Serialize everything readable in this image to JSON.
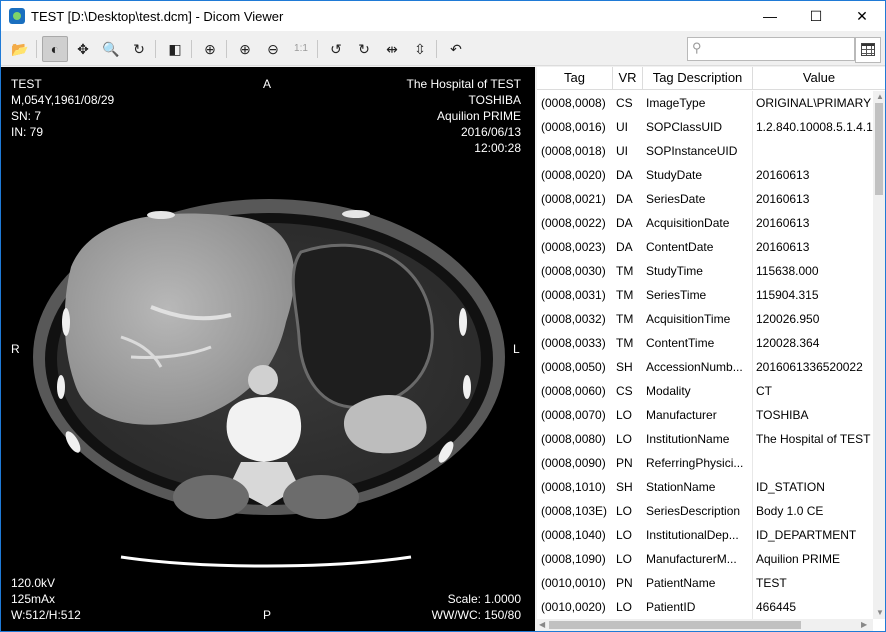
{
  "window": {
    "title": "TEST [D:\\Desktop\\test.dcm] - Dicom Viewer"
  },
  "titlebar_buttons": {
    "minimize": "—",
    "maximize": "☐",
    "close": "✕"
  },
  "toolbar": {
    "buttons": [
      {
        "icon": "open-folder-icon",
        "glyph": "📂"
      },
      {
        "icon": "contrast-icon",
        "glyph": "◐"
      },
      {
        "icon": "pan-icon",
        "glyph": "✥"
      },
      {
        "icon": "zoom-icon",
        "glyph": "🔍"
      },
      {
        "icon": "rotate-icon",
        "glyph": "↻"
      },
      {
        "icon": "invert-icon",
        "glyph": "◧"
      },
      {
        "icon": "fit-icon",
        "glyph": "⊕"
      },
      {
        "icon": "zoom-in-icon",
        "glyph": "⊕"
      },
      {
        "icon": "zoom-out-icon",
        "glyph": "⊖"
      },
      {
        "icon": "actual-size-icon",
        "glyph": "1:1"
      },
      {
        "icon": "rotate-left-icon",
        "glyph": "↺"
      },
      {
        "icon": "rotate-right-icon",
        "glyph": "↻"
      },
      {
        "icon": "flip-horizontal-icon",
        "glyph": "⇹"
      },
      {
        "icon": "flip-vertical-icon",
        "glyph": "⇳"
      },
      {
        "icon": "reset-icon",
        "glyph": "↶"
      }
    ],
    "search_placeholder": ""
  },
  "overlay": {
    "top_left": [
      "TEST",
      "M,054Y,1961/08/29",
      "SN: 7",
      "IN: 79"
    ],
    "top_right": [
      "The Hospital of TEST",
      "TOSHIBA",
      "Aquilion PRIME",
      "2016/06/13",
      "12:00:28"
    ],
    "bottom_left": [
      "120.0kV",
      "125mAx",
      "W:512/H:512"
    ],
    "bottom_right": [
      "Scale: 1.0000",
      "WW/WC: 150/80"
    ],
    "orient_top": "A",
    "orient_bottom": "P",
    "orient_left": "R",
    "orient_right": "L"
  },
  "table": {
    "headers": {
      "tag": "Tag",
      "vr": "VR",
      "desc": "Tag Description",
      "value": "Value"
    },
    "rows": [
      {
        "tag": "(0008,0008)",
        "vr": "CS",
        "desc": "ImageType",
        "value": "ORIGINAL\\PRIMARY"
      },
      {
        "tag": "(0008,0016)",
        "vr": "UI",
        "desc": "SOPClassUID",
        "value": "1.2.840.10008.5.1.4.1"
      },
      {
        "tag": "(0008,0018)",
        "vr": "UI",
        "desc": "SOPInstanceUID",
        "value": ""
      },
      {
        "tag": "(0008,0020)",
        "vr": "DA",
        "desc": "StudyDate",
        "value": "20160613"
      },
      {
        "tag": "(0008,0021)",
        "vr": "DA",
        "desc": "SeriesDate",
        "value": "20160613"
      },
      {
        "tag": "(0008,0022)",
        "vr": "DA",
        "desc": "AcquisitionDate",
        "value": "20160613"
      },
      {
        "tag": "(0008,0023)",
        "vr": "DA",
        "desc": "ContentDate",
        "value": "20160613"
      },
      {
        "tag": "(0008,0030)",
        "vr": "TM",
        "desc": "StudyTime",
        "value": "115638.000"
      },
      {
        "tag": "(0008,0031)",
        "vr": "TM",
        "desc": "SeriesTime",
        "value": "115904.315"
      },
      {
        "tag": "(0008,0032)",
        "vr": "TM",
        "desc": "AcquisitionTime",
        "value": "120026.950"
      },
      {
        "tag": "(0008,0033)",
        "vr": "TM",
        "desc": "ContentTime",
        "value": "120028.364"
      },
      {
        "tag": "(0008,0050)",
        "vr": "SH",
        "desc": "AccessionNumb...",
        "value": "2016061336520022"
      },
      {
        "tag": "(0008,0060)",
        "vr": "CS",
        "desc": "Modality",
        "value": "CT"
      },
      {
        "tag": "(0008,0070)",
        "vr": "LO",
        "desc": "Manufacturer",
        "value": "TOSHIBA"
      },
      {
        "tag": "(0008,0080)",
        "vr": "LO",
        "desc": "InstitutionName",
        "value": "The Hospital of TEST"
      },
      {
        "tag": "(0008,0090)",
        "vr": "PN",
        "desc": "ReferringPhysici...",
        "value": ""
      },
      {
        "tag": "(0008,1010)",
        "vr": "SH",
        "desc": "StationName",
        "value": "ID_STATION"
      },
      {
        "tag": "(0008,103E)",
        "vr": "LO",
        "desc": "SeriesDescription",
        "value": "Body 1.0 CE"
      },
      {
        "tag": "(0008,1040)",
        "vr": "LO",
        "desc": "InstitutionalDep...",
        "value": "ID_DEPARTMENT"
      },
      {
        "tag": "(0008,1090)",
        "vr": "LO",
        "desc": "ManufacturerM...",
        "value": "Aquilion PRIME"
      },
      {
        "tag": "(0010,0010)",
        "vr": "PN",
        "desc": "PatientName",
        "value": "TEST"
      },
      {
        "tag": "(0010,0020)",
        "vr": "LO",
        "desc": "PatientID",
        "value": "466445"
      }
    ]
  }
}
